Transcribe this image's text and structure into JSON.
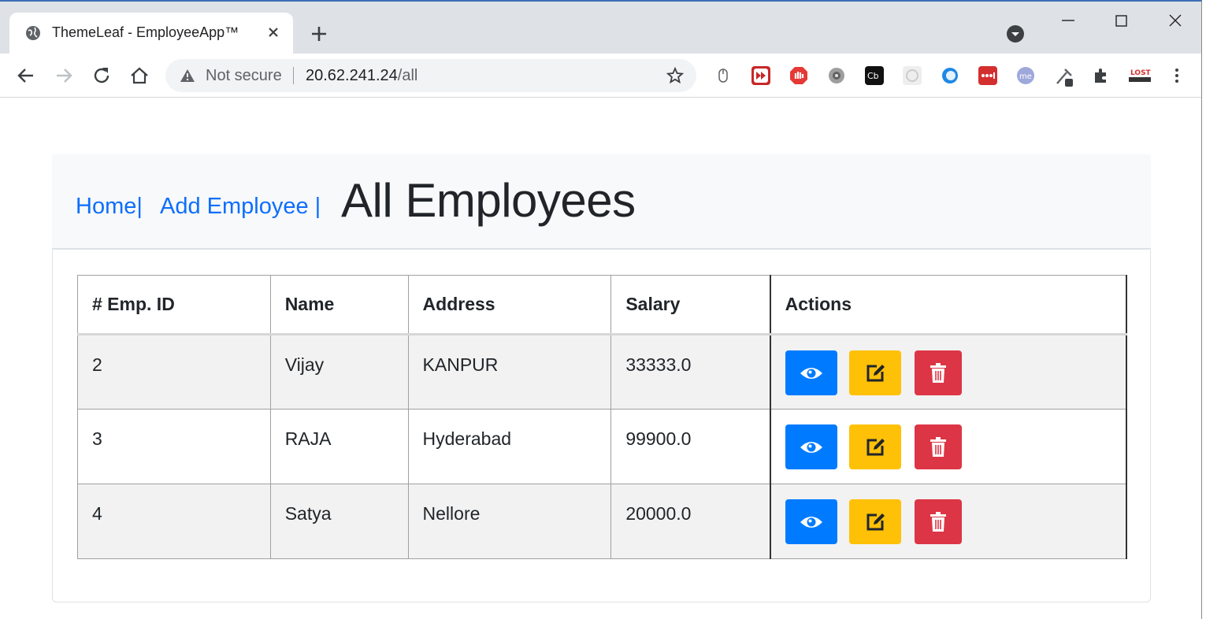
{
  "browser": {
    "tab_title": "ThemeLeaf - EmployeeApp™",
    "security_label": "Not secure",
    "url_host": "20.62.241.24",
    "url_path": "/all"
  },
  "nav": {
    "home_label": "Home|",
    "add_label": "Add Employee |"
  },
  "page": {
    "title": "All Employees"
  },
  "table": {
    "headers": [
      "# Emp. ID",
      "Name",
      "Address",
      "Salary",
      "Actions"
    ],
    "rows": [
      {
        "id": "2",
        "name": "Vijay",
        "address": "KANPUR",
        "salary": "33333.0"
      },
      {
        "id": "3",
        "name": "RAJA",
        "address": "Hyderabad",
        "salary": "99900.0"
      },
      {
        "id": "4",
        "name": "Satya",
        "address": "Nellore",
        "salary": "20000.0"
      }
    ]
  },
  "colors": {
    "view_button": "#007bff",
    "edit_button": "#ffc107",
    "delete_button": "#dc3545",
    "link": "#0d6efd"
  },
  "icons": [
    "globe-icon",
    "close-icon",
    "plus-icon",
    "back-icon",
    "forward-icon",
    "reload-icon",
    "home-icon",
    "warning-icon",
    "star-icon",
    "eye-icon",
    "edit-icon",
    "trash-icon"
  ]
}
